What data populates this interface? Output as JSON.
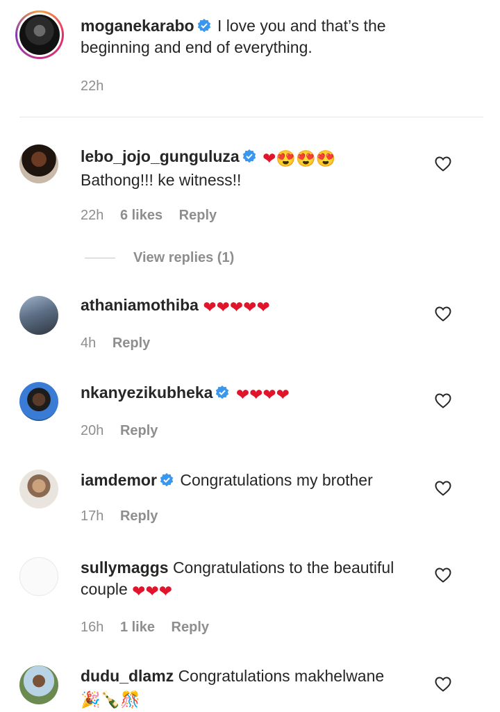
{
  "caption": {
    "username": "moganekarabo",
    "text": "I love you and that’s the beginning and end of everything.",
    "time": "22h"
  },
  "comments": [
    {
      "username": "lebo_jojo_gunguluza",
      "verified": true,
      "emojis": "❤😍😍😍",
      "text": "Bathong!!! ke witness!!",
      "time": "22h",
      "likes": "6 likes",
      "reply": "Reply"
    },
    {
      "username": "athaniamothiba",
      "verified": false,
      "emojis": "❤❤❤❤❤",
      "text": "",
      "time": "4h",
      "reply": "Reply"
    },
    {
      "username": "nkanyezikubheka",
      "verified": true,
      "emojis": "❤❤❤❤",
      "text": "",
      "time": "20h",
      "reply": "Reply"
    },
    {
      "username": "iamdemor",
      "verified": true,
      "text": "Congratulations my brother",
      "time": "17h",
      "reply": "Reply"
    },
    {
      "username": "sullymaggs",
      "verified": false,
      "text": "Congratulations to the beautiful couple",
      "emojis": "❤❤❤",
      "time": "16h",
      "likes": "1 like",
      "reply": "Reply"
    },
    {
      "username": "dudu_dlamz",
      "verified": false,
      "text": "Congratulations makhelwane",
      "emojis": "🎉🍾🎊"
    }
  ],
  "view_replies": "View replies (1)",
  "colors": {
    "heart": "#e0142b",
    "verified": "#3897f0",
    "muted": "#8e8e8e"
  }
}
